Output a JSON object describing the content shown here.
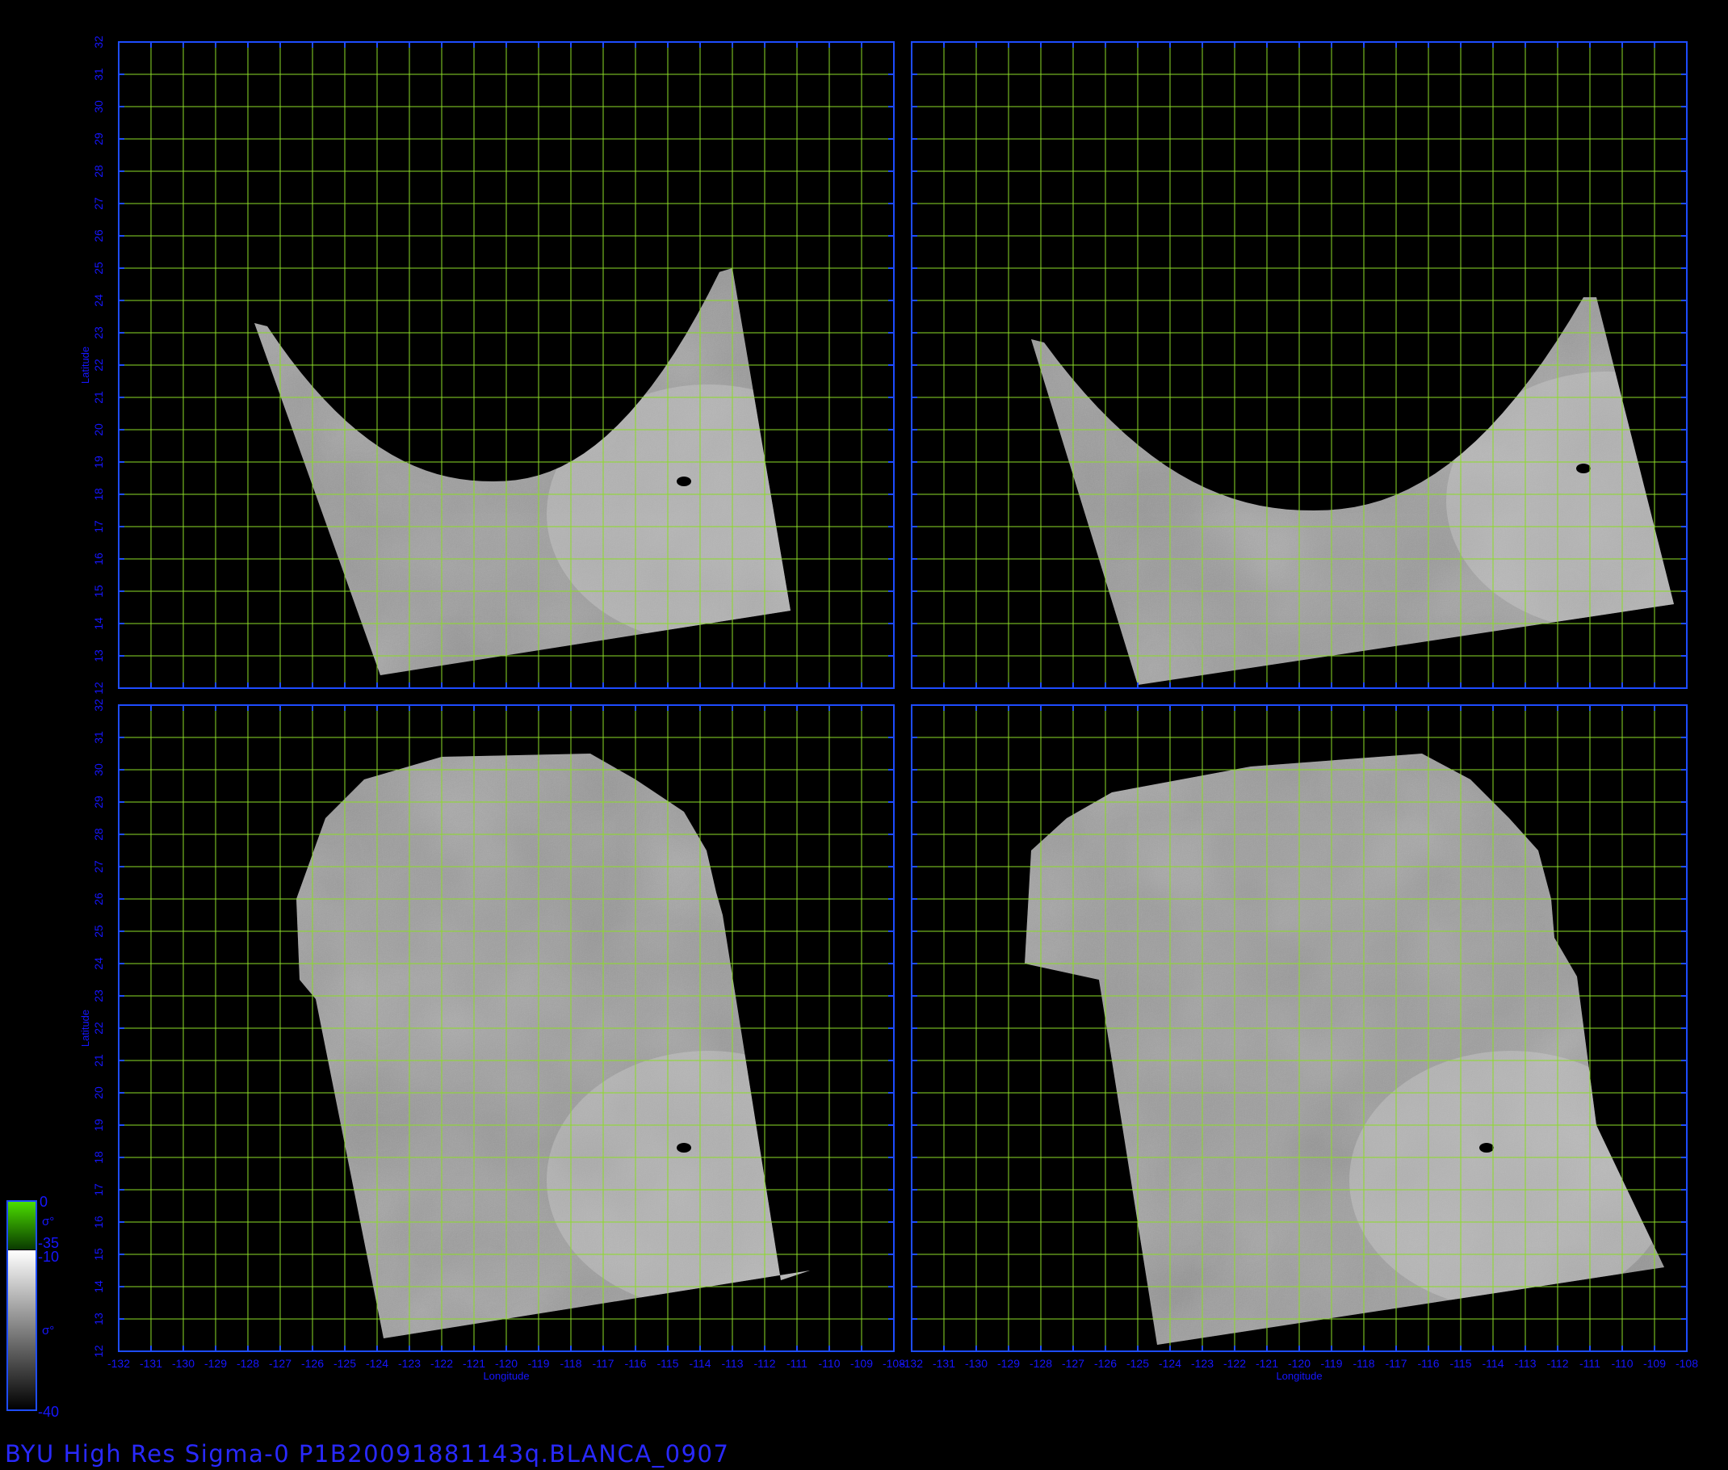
{
  "title": "BYU  High  Res  Sigma-0  P1B20091881143q.BLANCA_0907",
  "axes": {
    "xlabel": "Longitude",
    "ylabel": "Latitude",
    "lon_range": [
      -132,
      -108
    ],
    "lat_range": [
      12,
      32
    ],
    "x_ticks": [
      -132,
      -131,
      -130,
      -129,
      -128,
      -127,
      -126,
      -125,
      -124,
      -123,
      -122,
      -121,
      -120,
      -119,
      -118,
      -117,
      -116,
      -115,
      -114,
      -113,
      -112,
      -111,
      -110,
      -109,
      -108
    ],
    "y_ticks": [
      12,
      13,
      14,
      15,
      16,
      17,
      18,
      19,
      20,
      21,
      22,
      23,
      24,
      25,
      26,
      27,
      28,
      29,
      30,
      31,
      32
    ],
    "grid": true,
    "grid_color": "#8cdc28",
    "axis_color": "#1e4cff",
    "tick_label_color": "#1616ff"
  },
  "colorbar": {
    "upper": {
      "max_label": "0",
      "symbol_label": "σ°",
      "min_label": "-35",
      "color_top": "#4ce000",
      "color_bottom": "#0a3a00"
    },
    "lower": {
      "max_label": "-10",
      "symbol_label": "σ°",
      "min_label": "-40",
      "color_top": "#ffffff",
      "color_bottom": "#000000"
    }
  },
  "panels": [
    {
      "id": "top-left",
      "swath": "arc",
      "hurricane_eye": [
        -114.5,
        18.4
      ]
    },
    {
      "id": "top-right",
      "swath": "arc",
      "hurricane_eye": [
        -111.2,
        18.8
      ]
    },
    {
      "id": "bottom-left",
      "swath": "full",
      "hurricane_eye": [
        -114.5,
        18.3
      ]
    },
    {
      "id": "bottom-right",
      "swath": "full",
      "hurricane_eye": [
        -114.2,
        18.3
      ]
    }
  ],
  "colors": {
    "background": "#000000",
    "title": "#2929ff"
  }
}
